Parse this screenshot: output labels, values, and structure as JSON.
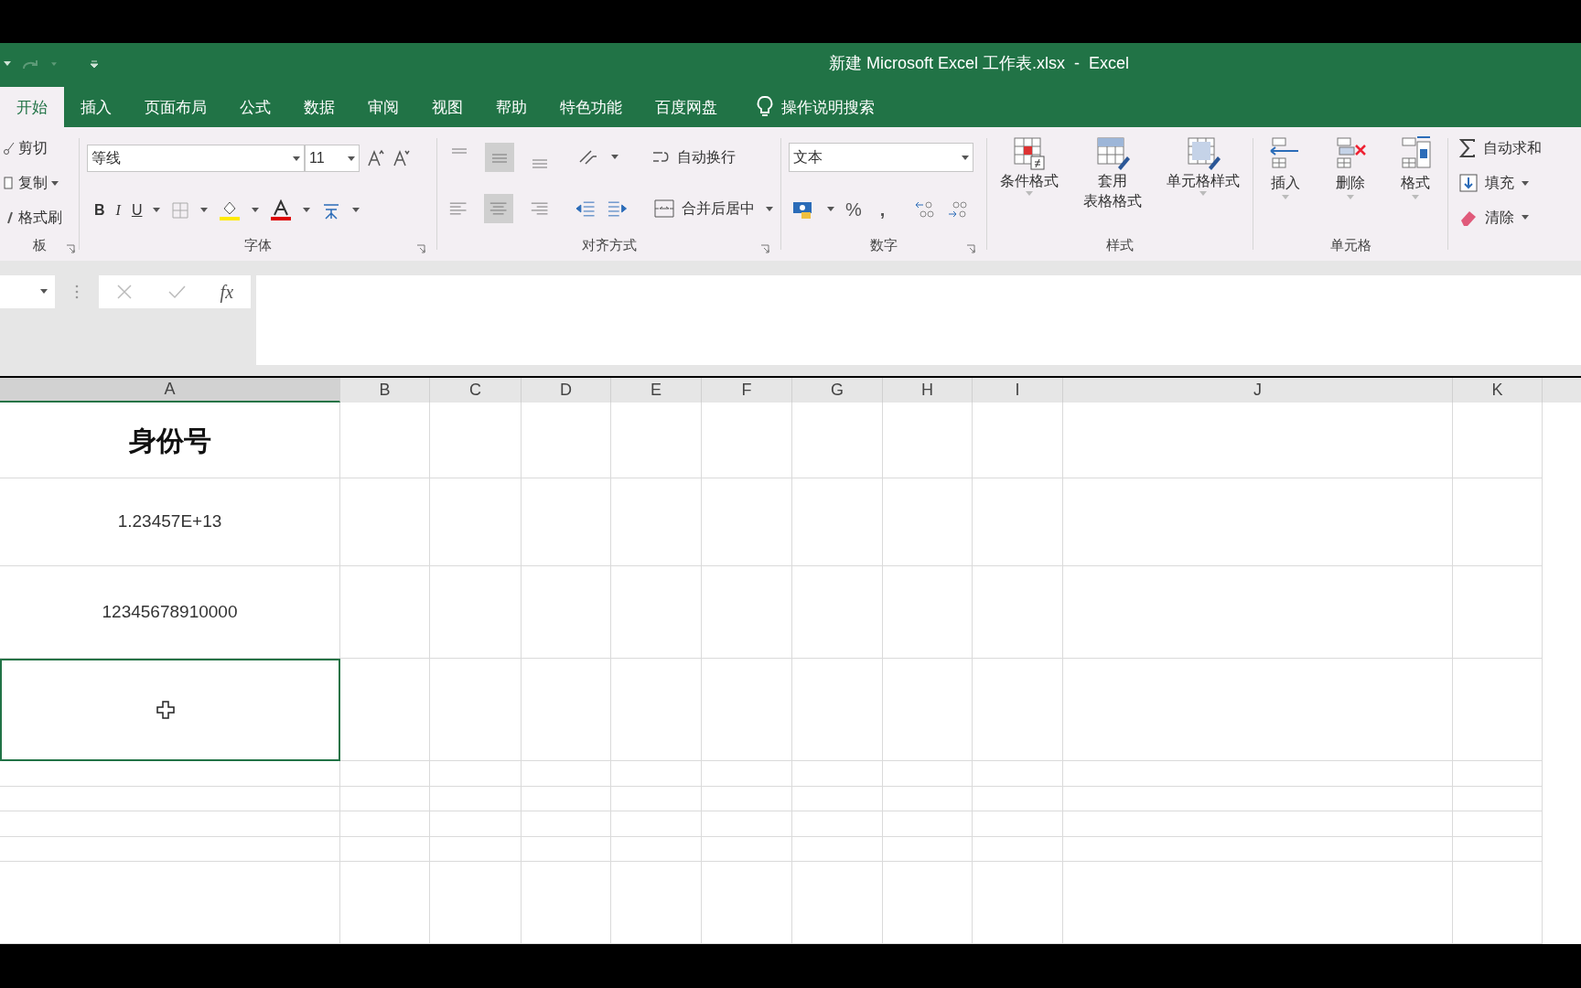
{
  "window": {
    "title": "新建 Microsoft Excel 工作表.xlsx  -  Excel"
  },
  "tabs": [
    {
      "label": "开始",
      "selected": true
    },
    {
      "label": "插入",
      "selected": false
    },
    {
      "label": "页面布局",
      "selected": false
    },
    {
      "label": "公式",
      "selected": false
    },
    {
      "label": "数据",
      "selected": false
    },
    {
      "label": "审阅",
      "selected": false
    },
    {
      "label": "视图",
      "selected": false
    },
    {
      "label": "帮助",
      "selected": false
    },
    {
      "label": "特色功能",
      "selected": false
    },
    {
      "label": "百度网盘",
      "selected": false
    }
  ],
  "tell_me": "操作说明搜索",
  "ribbon": {
    "clipboard": {
      "items": [
        "剪切",
        "复制",
        "格式刷"
      ],
      "label": "板"
    },
    "font": {
      "font_name": "等线",
      "font_size": "11",
      "bold": "B",
      "italic": "I",
      "underline": "U",
      "label": "字体"
    },
    "alignment": {
      "wrap": "自动换行",
      "merge": "合并后居中",
      "label": "对齐方式"
    },
    "number": {
      "format": "文本",
      "percent": "%",
      "comma": ",",
      "label": "数字"
    },
    "styles": {
      "items": [
        {
          "lines": [
            "条件格式"
          ]
        },
        {
          "lines": [
            "套用",
            "表格格式"
          ]
        },
        {
          "lines": [
            "单元格样式"
          ]
        }
      ],
      "label": "样式"
    },
    "cells": {
      "items": [
        "插入",
        "删除",
        "格式"
      ],
      "label": "单元格"
    },
    "editing": {
      "items": [
        "自动求和",
        "填充",
        "清除"
      ]
    }
  },
  "formula_bar": {
    "fx": "fx"
  },
  "columns": [
    {
      "label": "A",
      "selected": true
    },
    {
      "label": "B",
      "selected": false
    },
    {
      "label": "C",
      "selected": false
    },
    {
      "label": "D",
      "selected": false
    },
    {
      "label": "E",
      "selected": false
    },
    {
      "label": "F",
      "selected": false
    },
    {
      "label": "G",
      "selected": false
    },
    {
      "label": "H",
      "selected": false
    },
    {
      "label": "I",
      "selected": false
    },
    {
      "label": "J",
      "selected": false
    },
    {
      "label": "K",
      "selected": false
    }
  ],
  "rows": [
    {
      "cell_a": "身份号",
      "bold": true,
      "selected": false
    },
    {
      "cell_a": "1.23457E+13",
      "bold": false,
      "selected": false
    },
    {
      "cell_a": "12345678910000",
      "bold": false,
      "selected": false
    },
    {
      "cell_a": "",
      "bold": false,
      "selected": true
    }
  ]
}
